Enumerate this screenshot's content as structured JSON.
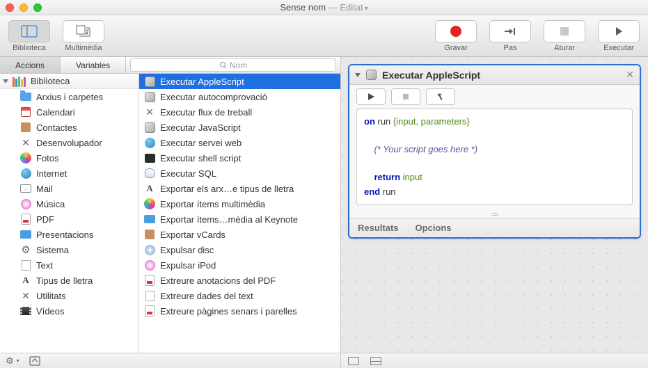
{
  "title": {
    "name": "Sense nom",
    "sep": " — ",
    "status": "Editat"
  },
  "toolbar": {
    "biblioteca": "Biblioteca",
    "multimedia": "Multimèdia",
    "gravar": "Gravar",
    "pas": "Pas",
    "aturar": "Aturar",
    "executar": "Executar"
  },
  "tabs": {
    "accions": "Accions",
    "variables": "Variables"
  },
  "search": {
    "placeholder": "Nom"
  },
  "library": {
    "header": "Biblioteca",
    "items": [
      {
        "label": "Arxius i carpetes",
        "icon": "folder"
      },
      {
        "label": "Calendari",
        "icon": "cal"
      },
      {
        "label": "Contactes",
        "icon": "contact"
      },
      {
        "label": "Desenvolupador",
        "icon": "dev"
      },
      {
        "label": "Fotos",
        "icon": "photo"
      },
      {
        "label": "Internet",
        "icon": "globe"
      },
      {
        "label": "Mail",
        "icon": "mail"
      },
      {
        "label": "Música",
        "icon": "music"
      },
      {
        "label": "PDF",
        "icon": "pdf"
      },
      {
        "label": "Presentacions",
        "icon": "keynote"
      },
      {
        "label": "Sistema",
        "icon": "gear"
      },
      {
        "label": "Text",
        "icon": "text"
      },
      {
        "label": "Tipus de lletra",
        "icon": "font"
      },
      {
        "label": "Utilitats",
        "icon": "util"
      },
      {
        "label": "Vídeos",
        "icon": "video"
      }
    ]
  },
  "actions": {
    "selectedIndex": 0,
    "items": [
      {
        "label": "Executar AppleScript",
        "icon": "script"
      },
      {
        "label": "Executar autocomprovació",
        "icon": "script"
      },
      {
        "label": "Executar flux de treball",
        "icon": "util"
      },
      {
        "label": "Executar JavaScript",
        "icon": "script"
      },
      {
        "label": "Executar servei web",
        "icon": "globe"
      },
      {
        "label": "Executar shell script",
        "icon": "term"
      },
      {
        "label": "Executar SQL",
        "icon": "db"
      },
      {
        "label": "Exportar els arx…e tipus de lletra",
        "icon": "font"
      },
      {
        "label": "Exportar ítems multimèdia",
        "icon": "photo"
      },
      {
        "label": "Exportar ítems…mèdia al Keynote",
        "icon": "keynote"
      },
      {
        "label": "Exportar vCards",
        "icon": "contact"
      },
      {
        "label": "Expulsar disc",
        "icon": "disc"
      },
      {
        "label": "Expulsar iPod",
        "icon": "music"
      },
      {
        "label": "Extreure anotacions del PDF",
        "icon": "pdf"
      },
      {
        "label": "Extreure dades del text",
        "icon": "text"
      },
      {
        "label": "Extreure pàgines senars i parelles",
        "icon": "pdf"
      }
    ]
  },
  "card": {
    "title": "Executar AppleScript",
    "resultats": "Resultats",
    "opcions": "Opcions",
    "code": {
      "l1a": "on",
      "l1b": " run ",
      "l1c": "{input, parameters}",
      "l2": "    (* Your script goes here *)",
      "l3a": "    ",
      "l3b": "return",
      "l3c": " input",
      "l4a": "end",
      "l4b": " run"
    }
  }
}
